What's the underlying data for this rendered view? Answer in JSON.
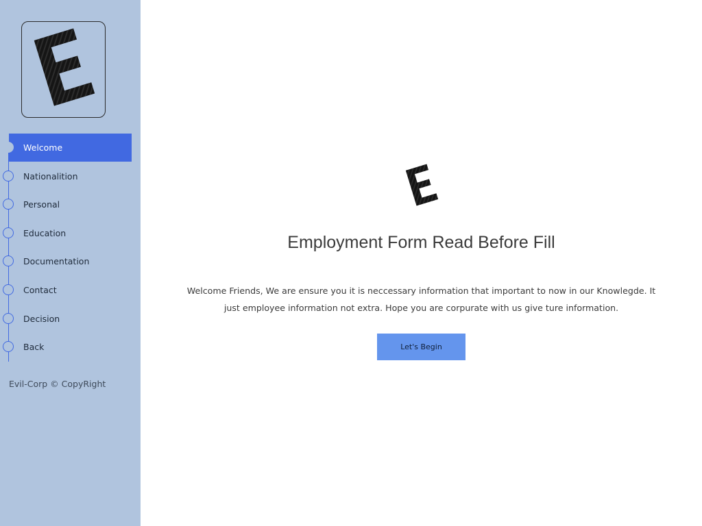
{
  "brand": {
    "logo_letter": "E",
    "accent_color": "#4169e1",
    "sidebar_color": "#b0c4de",
    "button_color": "#6495ed"
  },
  "sidebar": {
    "items": [
      {
        "label": "Welcome",
        "active": true
      },
      {
        "label": "Nationalition",
        "active": false
      },
      {
        "label": "Personal",
        "active": false
      },
      {
        "label": "Education",
        "active": false
      },
      {
        "label": "Documentation",
        "active": false
      },
      {
        "label": "Contact",
        "active": false
      },
      {
        "label": "Decision",
        "active": false
      },
      {
        "label": "Back",
        "active": false
      }
    ],
    "copyright": "Evil-Corp © CopyRight"
  },
  "main": {
    "title": "Employment Form Read Before Fill",
    "description": "Welcome Friends, We are ensure you it is neccessary information that important to now in our Knowlegde. It just employee information not extra. Hope you are corpurate with us give ture information.",
    "begin_label": "Let's Begin"
  }
}
